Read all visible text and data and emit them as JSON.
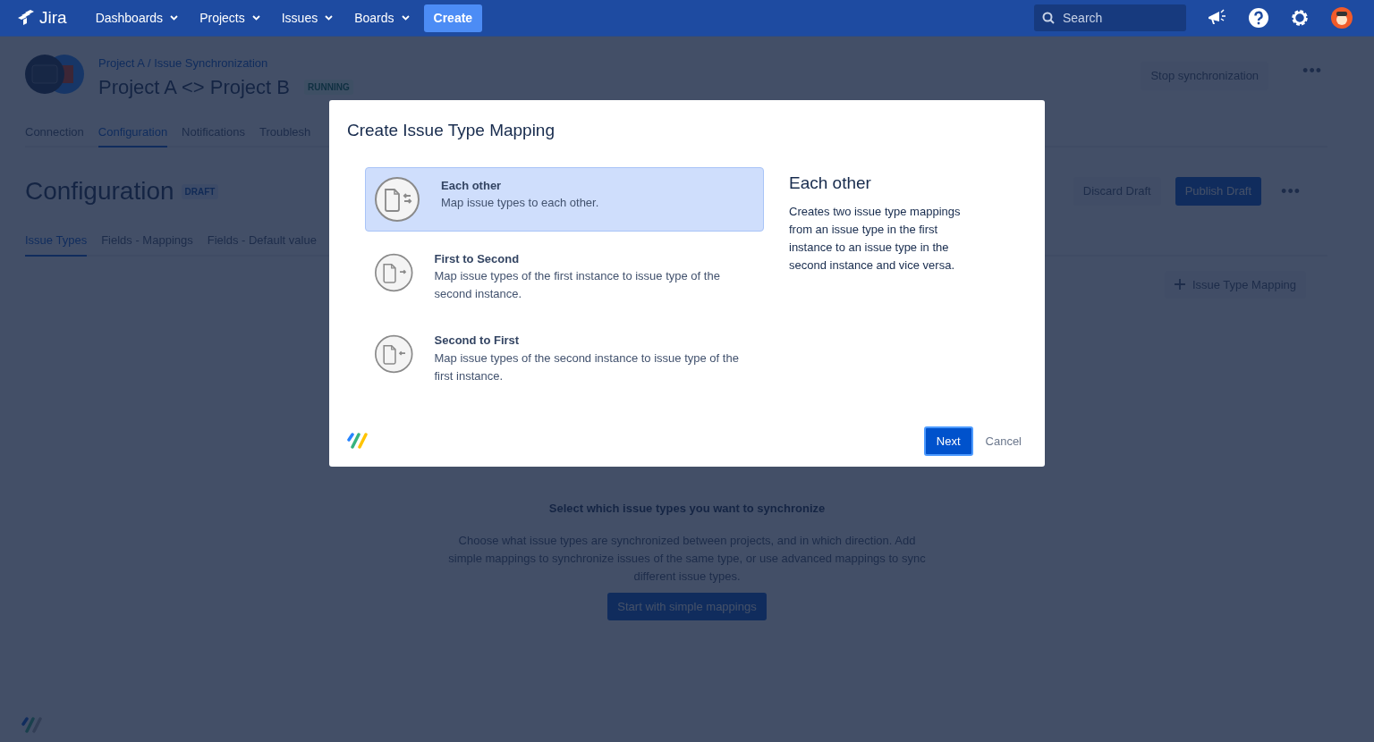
{
  "navbar": {
    "logo": "Jira",
    "menus": [
      "Dashboards",
      "Projects",
      "Issues",
      "Boards"
    ],
    "create": "Create",
    "search": {
      "placeholder": "Search"
    }
  },
  "header": {
    "breadcrumb": "Project A / Issue Synchronization",
    "title": "Project A <> Project B",
    "status": "RUNNING",
    "stop_button": "Stop synchronization",
    "more_button": "•••"
  },
  "tabs": [
    {
      "label": "Connection",
      "selected": false
    },
    {
      "label": "Configuration",
      "selected": true
    },
    {
      "label": "Notifications",
      "selected": false
    },
    {
      "label": "Troublesh",
      "selected": false
    }
  ],
  "configuration": {
    "title": "Configuration",
    "badge": "DRAFT",
    "actions": [
      {
        "label": "Discard Draft",
        "kind": "secondary"
      },
      {
        "label": "Publish Draft",
        "kind": "primary"
      }
    ],
    "more_button": "•••",
    "subtabs": [
      {
        "label": "Issue Types",
        "selected": true
      },
      {
        "label": "Fields - Mappings",
        "selected": false
      },
      {
        "label": "Fields - Default value",
        "selected": false
      }
    ],
    "add_button": "Issue Type Mapping",
    "empty_state": {
      "title": "Select which issue types you want to synchronize",
      "text": "Choose what issue types are synchronized between projects, and in which direction. Add simple mappings to synchronize issues of the same type, or use advanced mappings to sync different issue types.",
      "button": "Start with simple mappings"
    }
  },
  "modal": {
    "title": "Create Issue Type Mapping",
    "options": [
      {
        "title": "Each other",
        "description": "Map issue types to each other.",
        "selected": true,
        "kind": "both"
      },
      {
        "title": "First to Second",
        "description": "Map issue types of the first instance to issue type of the second instance.",
        "selected": false,
        "kind": "forward"
      },
      {
        "title": "Second to First",
        "description": "Map issue types of the second instance to issue type of the first instance.",
        "selected": false,
        "kind": "backward"
      }
    ],
    "detail": {
      "title": "Each other",
      "text": "Creates two issue type mappings from an issue type in the first instance to an issue type in the second instance and vice versa."
    },
    "next": "Next",
    "cancel": "Cancel"
  }
}
